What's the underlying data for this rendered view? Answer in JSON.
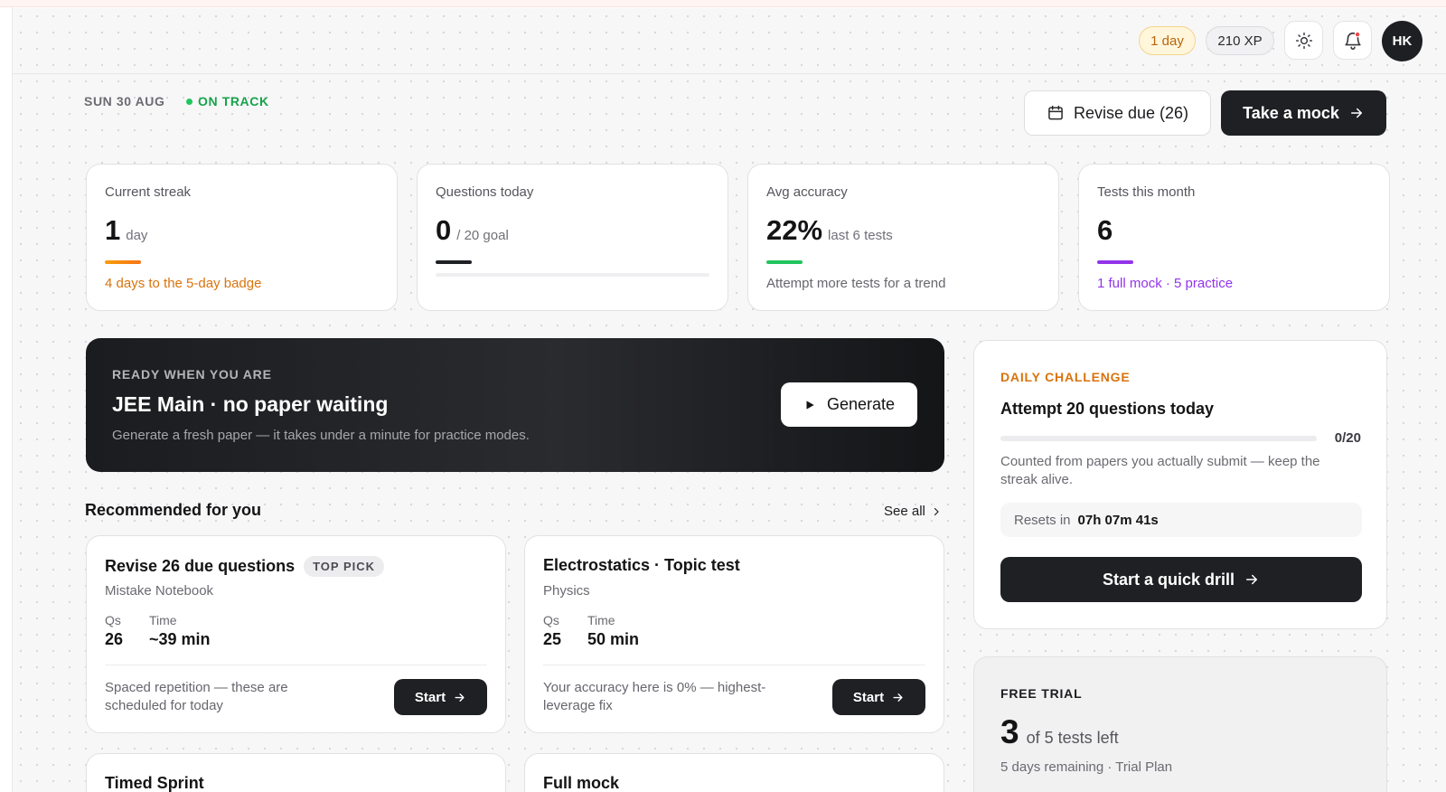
{
  "header": {
    "streak_pill": "1 day",
    "xp_pill": "210 XP",
    "avatar_initials": "HK",
    "date": "SUN 30 AUG",
    "status": "ON TRACK",
    "revise_button": "Revise due (26)",
    "mock_button": "Take a mock"
  },
  "stats": [
    {
      "label": "Current streak",
      "value": "1",
      "unit": "day",
      "sub": "4 days to the 5-day badge",
      "progress": 0.2
    },
    {
      "label": "Questions today",
      "value": "0",
      "unit": "/ 20 goal",
      "sub": "",
      "progress": 0
    },
    {
      "label": "Avg accuracy",
      "value": "22%",
      "unit": "last 6 tests",
      "sub": "Attempt more tests for a trend"
    },
    {
      "label": "Tests this month",
      "value": "6",
      "unit": "",
      "sub": "1 full mock · 5 practice"
    }
  ],
  "hero": {
    "kicker": "READY WHEN YOU ARE",
    "title": "JEE Main · no paper waiting",
    "desc": "Generate a fresh paper — it takes under a minute for practice modes.",
    "button": "Generate"
  },
  "recommended": {
    "title": "Recommended for you",
    "see_all": "See all",
    "metric_labels": {
      "qs": "Qs",
      "time": "Time"
    },
    "start_label": "Start",
    "cards": [
      {
        "title": "Revise 26 due questions",
        "badge": "TOP PICK",
        "subtitle": "Mistake Notebook",
        "qs": "26",
        "time": "~39 min",
        "note": "Spaced repetition — these are scheduled for today"
      },
      {
        "title": "Electrostatics · Topic test",
        "badge": "",
        "subtitle": "Physics",
        "qs": "25",
        "time": "50 min",
        "note": "Your accuracy here is 0% — highest-leverage fix"
      },
      {
        "title": "Timed Sprint"
      },
      {
        "title": "Full mock"
      }
    ]
  },
  "daily_challenge": {
    "kicker": "DAILY CHALLENGE",
    "title": "Attempt 20 questions today",
    "count": "0/20",
    "progress": 0,
    "desc": "Counted from papers you actually submit — keep the streak alive.",
    "reset_label": "Resets in",
    "reset_time": "07h 07m 41s",
    "button": "Start a quick drill"
  },
  "free_trial": {
    "kicker": "FREE TRIAL",
    "count": "3",
    "count_suffix": "of 5 tests left",
    "sub": "5 days remaining · Trial Plan"
  },
  "colors": {
    "accent_dark": "#1f2023",
    "streak_orange": "#d9730d",
    "accuracy_green": "#22c55e",
    "tests_purple": "#9333ea",
    "ontrack_green": "#17a34a"
  }
}
